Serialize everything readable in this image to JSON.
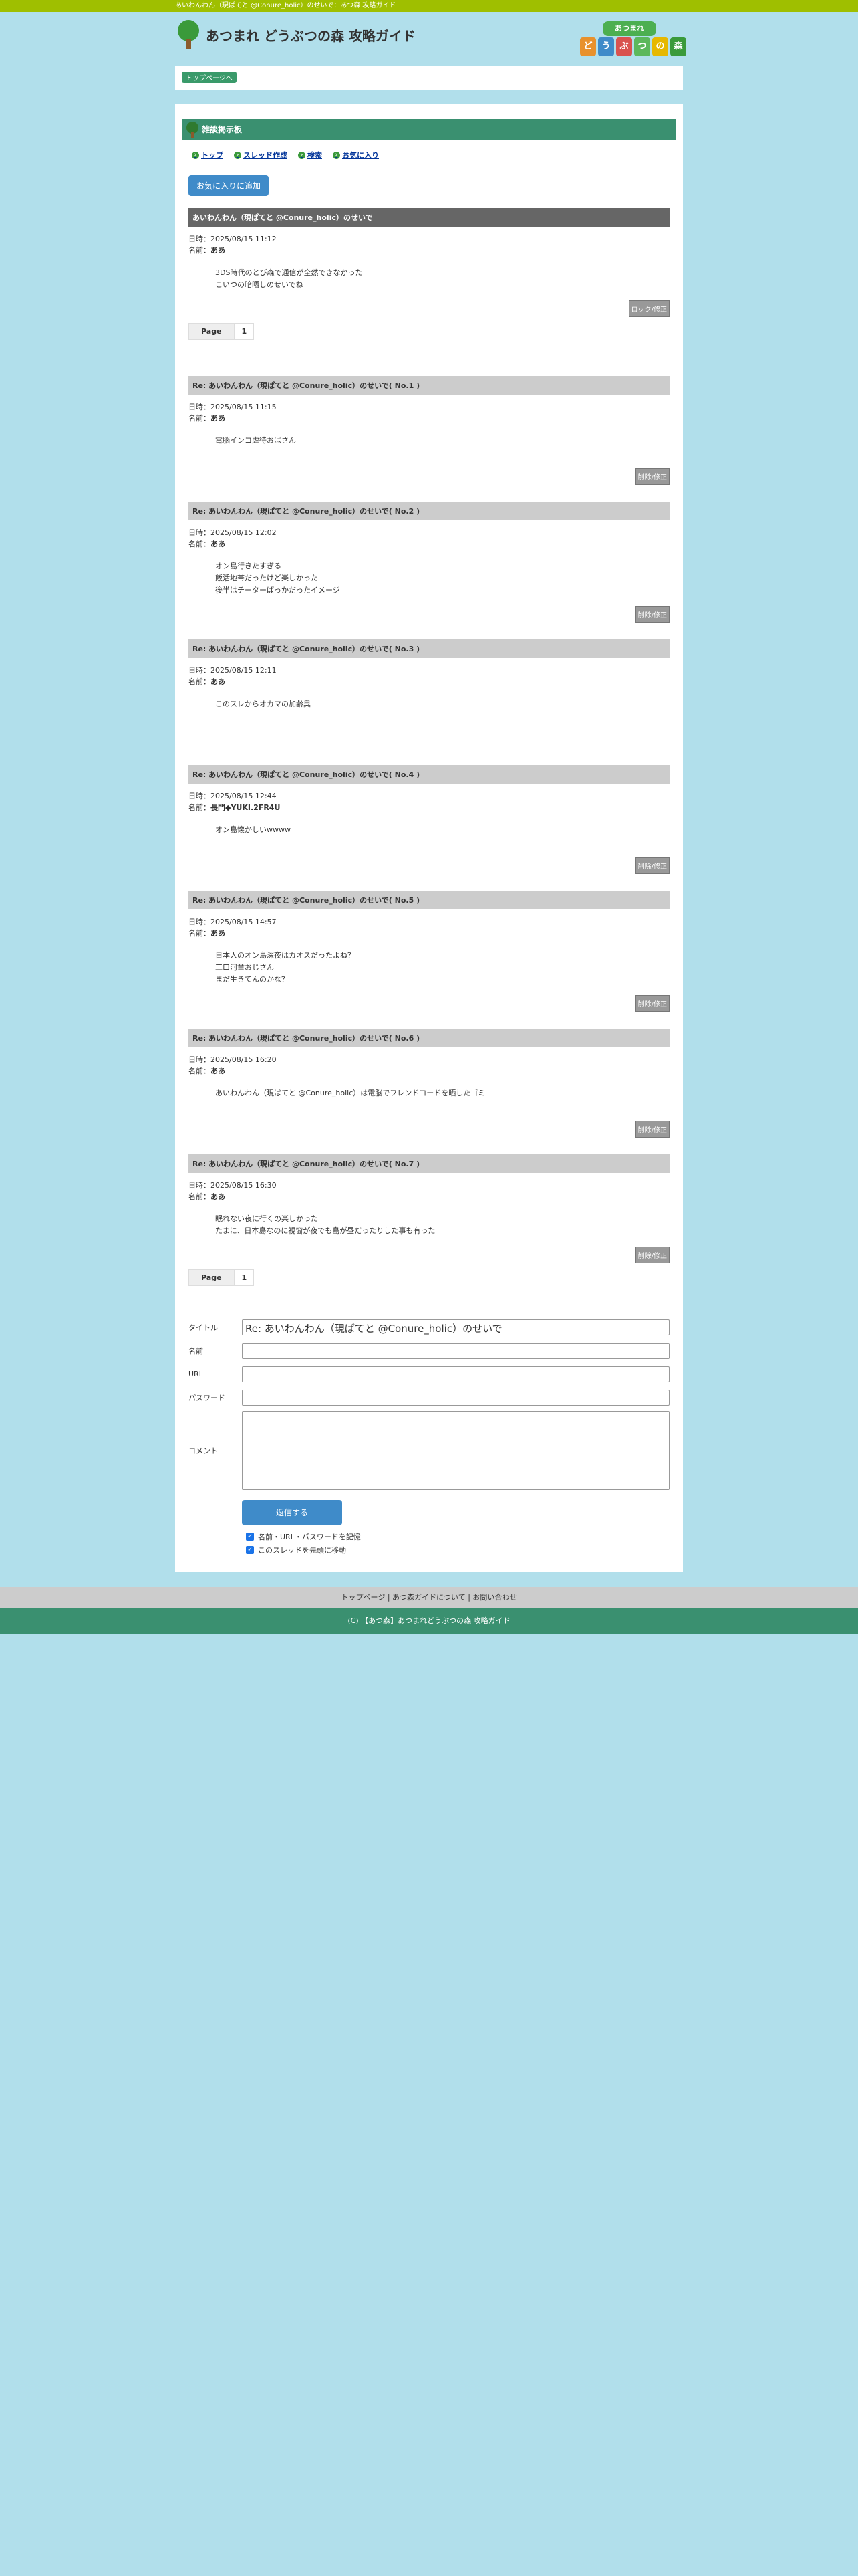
{
  "topbar": {
    "text": "あいわんわん（現ぱてと @Conure_holic）のせいで：あつ森 攻略ガイド"
  },
  "header": {
    "site_title": "あつまれ どうぶつの森 攻略ガイド",
    "badge_top": "あつまれ",
    "badge_tiles": [
      "ど",
      "う",
      "ぶ",
      "つ",
      "の",
      "森"
    ]
  },
  "breadcrumb": {
    "label": "トップページへ"
  },
  "board": {
    "heading": "雑談掲示板",
    "nav": [
      "トップ",
      "スレッド作成",
      "検索",
      "お気に入り"
    ],
    "fav_button": "お気に入りに追加"
  },
  "thread": {
    "title": "あいわんわん（現ぱてと @Conure_holic）のせいで",
    "date_label": "日時：",
    "name_label": "名前：",
    "date": "2025/08/15 11:12",
    "name": "ああ",
    "body": [
      "3DS時代のとび森で通信が全然できなかった",
      "こいつの暗晒しのせいでね"
    ],
    "button": "ロック/修正"
  },
  "pager": {
    "label": "Page",
    "page": "1"
  },
  "replies": [
    {
      "title": "Re: あいわんわん（現ぱてと @Conure_holic）のせいで( No.1 )",
      "date": "2025/08/15 11:15",
      "name": "ああ",
      "body": [
        "電脳インコ虐待おばさん"
      ],
      "button": "削除/修正"
    },
    {
      "title": "Re: あいわんわん（現ぱてと @Conure_holic）のせいで( No.2 )",
      "date": "2025/08/15 12:02",
      "name": "ああ",
      "body": [
        "オン島行きたすぎる",
        "飯活地帯だったけど楽しかった",
        "後半はチーターばっかだったイメージ"
      ],
      "button": "削除/修正"
    },
    {
      "title": "Re: あいわんわん（現ぱてと @Conure_holic）のせいで( No.3 )",
      "date": "2025/08/15 12:11",
      "name": "ああ",
      "body": [
        "このスレからオカマの加齢臭"
      ],
      "button": ""
    },
    {
      "title": "Re: あいわんわん（現ぱてと @Conure_holic）のせいで( No.4 )",
      "date": "2025/08/15 12:44",
      "name": "長門◆YUKI.2FR4U",
      "body": [
        "オン島懐かしいwwww"
      ],
      "button": "削除/修正"
    },
    {
      "title": "Re: あいわんわん（現ぱてと @Conure_holic）のせいで( No.5 )",
      "date": "2025/08/15 14:57",
      "name": "ああ",
      "body": [
        "日本人のオン島深夜はカオスだったよね？",
        "工口河童おじさん",
        "まだ生きてんのかな？"
      ],
      "button": "削除/修正"
    },
    {
      "title": "Re: あいわんわん（現ぱてと @Conure_holic）のせいで( No.6 )",
      "date": "2025/08/15 16:20",
      "name": "ああ",
      "body": [
        "あいわんわん（現ぱてと @Conure_holic）は電脳でフレンドコードを晒したゴミ"
      ],
      "button": "削除/修正"
    },
    {
      "title": "Re: あいわんわん（現ぱてと @Conure_holic）のせいで( No.7 )",
      "date": "2025/08/15 16:30",
      "name": "ああ",
      "body": [
        "眠れない夜に行くの楽しかった",
        "たまに、日本島なのに視窗が夜でも島が昼だったりした事も有った"
      ],
      "button": "削除/修正"
    }
  ],
  "form": {
    "title_label": "タイトル",
    "title_value": "Re: あいわんわん（現ぱてと @Conure_holic）のせいで",
    "name_label": "名前",
    "url_label": "URL",
    "password_label": "パスワード",
    "comment_label": "コメント",
    "submit": "返信する",
    "check1": "名前・URL・パスワードを記憶",
    "check2": "このスレッドを先頭に移動"
  },
  "footer": {
    "links": "トップページ | あつ森ガイドについて | お問い合わせ",
    "copyright": "(C) 【あつ森】あつまれどうぶつの森 攻略ガイド"
  },
  "colors": {
    "topbar": "#9fbf00",
    "board_header": "#3a9070",
    "button_blue": "#3f8bc9",
    "background": "#b1dfeb"
  }
}
